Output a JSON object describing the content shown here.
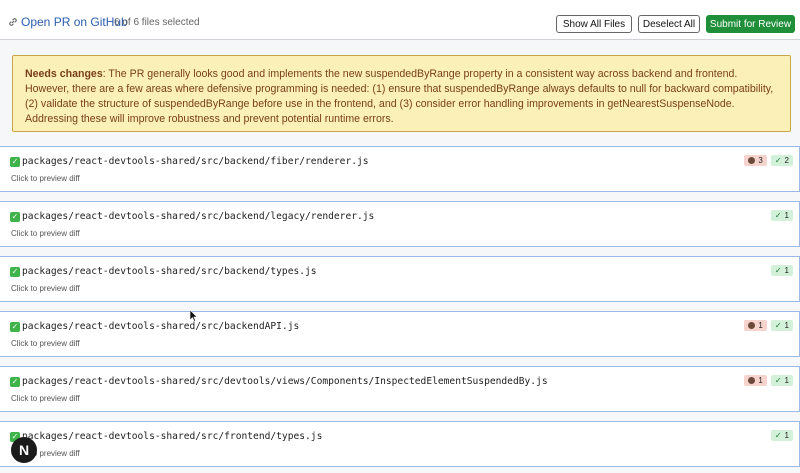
{
  "header": {
    "open_pr_label": "Open PR on GitHub",
    "selection_status": "6 of 6 files selected",
    "show_all_label": "Show All Files",
    "deselect_all_label": "Deselect All",
    "submit_label": "Submit for Review"
  },
  "review": {
    "status_label": "Needs changes",
    "message": ": The PR generally looks good and implements the new suspendedByRange property in a consistent way across backend and frontend. However, there are a few areas where defensive programming is needed: (1) ensure that suspendedByRange always defaults to null for backward compatibility, (2) validate the structure of suspendedByRange before use in the frontend, and (3) consider error handling improvements in getNearestSuspenseNode. Addressing these will improve robustness and prevent potential runtime errors."
  },
  "files": [
    {
      "path": "packages/react-devtools-shared/src/backend/fiber/renderer.js",
      "hint": "Click to preview diff",
      "bugs": "3",
      "ok": "2"
    },
    {
      "path": "packages/react-devtools-shared/src/backend/legacy/renderer.js",
      "hint": "Click to preview diff",
      "bugs": null,
      "ok": "1"
    },
    {
      "path": "packages/react-devtools-shared/src/backend/types.js",
      "hint": "Click to preview diff",
      "bugs": null,
      "ok": "1"
    },
    {
      "path": "packages/react-devtools-shared/src/backendAPI.js",
      "hint": "Click to preview diff",
      "bugs": "1",
      "ok": "1"
    },
    {
      "path": "packages/react-devtools-shared/src/devtools/views/Components/InspectedElementSuspendedBy.js",
      "hint": "Click to preview diff",
      "bugs": "1",
      "ok": "1"
    },
    {
      "path": "packages/react-devtools-shared/src/frontend/types.js",
      "hint": "Click to preview diff",
      "bugs": null,
      "ok": "1"
    }
  ],
  "fab_label": "N",
  "colors": {
    "submit_bg": "#1f8f3a",
    "notice_bg": "#fbf1b8",
    "notice_text": "#7a3e1a",
    "link": "#2a5db0"
  }
}
